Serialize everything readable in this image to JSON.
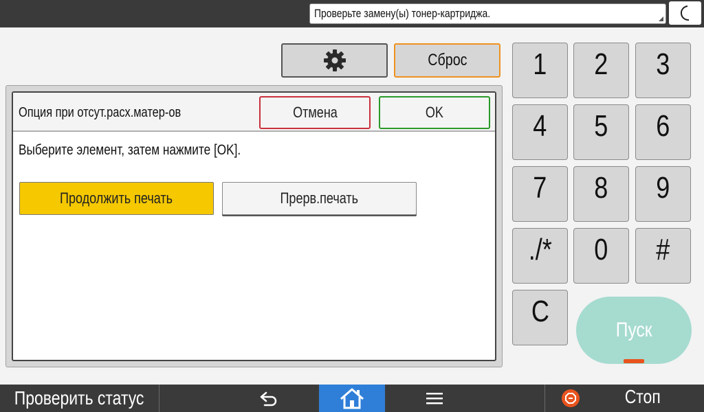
{
  "top_bar": {
    "message": "Проверьте замену(ы) тонер-картриджа."
  },
  "actions": {
    "reset_label": "Сброс"
  },
  "dialog": {
    "title": "Опция при отсут.расх.матер-ов",
    "cancel_label": "Отмена",
    "ok_label": "OK",
    "instruction": "Выберите элемент, затем нажмите [OK].",
    "options": [
      {
        "label": "Продолжить печать",
        "selected": true
      },
      {
        "label": "Прерв.печать",
        "selected": false
      }
    ]
  },
  "keypad": {
    "keys": [
      "1",
      "2",
      "3",
      "4",
      "5",
      "6",
      "7",
      "8",
      "9",
      "./*",
      "0",
      "#",
      "C"
    ],
    "start_label": "Пуск"
  },
  "bottom_bar": {
    "check_status_label": "Проверить статус",
    "stop_label": "Стоп"
  },
  "colors": {
    "selected_option": "#f5c800",
    "reset_border": "#f0921f",
    "cancel_border": "#c8303c",
    "ok_border": "#2a9a2a",
    "start_button": "#a6dbd0",
    "home_button": "#2f7fd8",
    "stop_icon": "#e9541e"
  },
  "icons": {
    "top_right": "moon-icon",
    "settings": "gear-icon",
    "back": "back-arrow-icon",
    "home": "home-icon",
    "menu": "menu-icon",
    "stop": "stop-icon"
  }
}
